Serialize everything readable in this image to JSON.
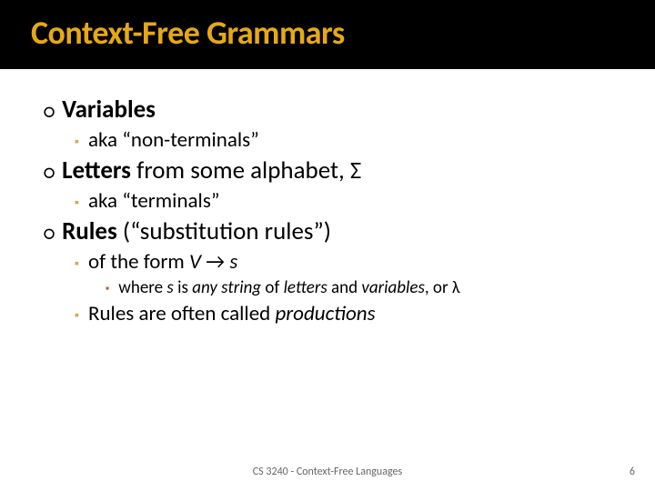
{
  "title": "Context-Free Grammars",
  "items": [
    {
      "level": 1,
      "bold_prefix": "Variables",
      "rest": ""
    },
    {
      "level": 2,
      "text": "aka “non-terminals”"
    },
    {
      "level": 1,
      "bold_prefix": "Letters",
      "rest": " from some alphabet, Σ"
    },
    {
      "level": 2,
      "text": "aka “terminals”"
    },
    {
      "level": 1,
      "bold_prefix": "Rules",
      "rest": " (“substitution rules”)"
    },
    {
      "level": 2,
      "html": "of the form <span class=\"italic\">V</span> → <span class=\"italic\">s</span>"
    },
    {
      "level": 3,
      "html": "where <span class=\"italic\">s</span> is <span class=\"italic\">any string</span> of <span class=\"italic\">letters</span> and <span class=\"italic\">variables</span>, or λ"
    },
    {
      "level": 2,
      "html": "Rules are often called <span class=\"italic\">productions</span>"
    }
  ],
  "footer": "CS 3240 - Context-Free Languages",
  "page": "6",
  "bullets": {
    "l1": "○",
    "l2": "▪",
    "l3": "▪"
  }
}
